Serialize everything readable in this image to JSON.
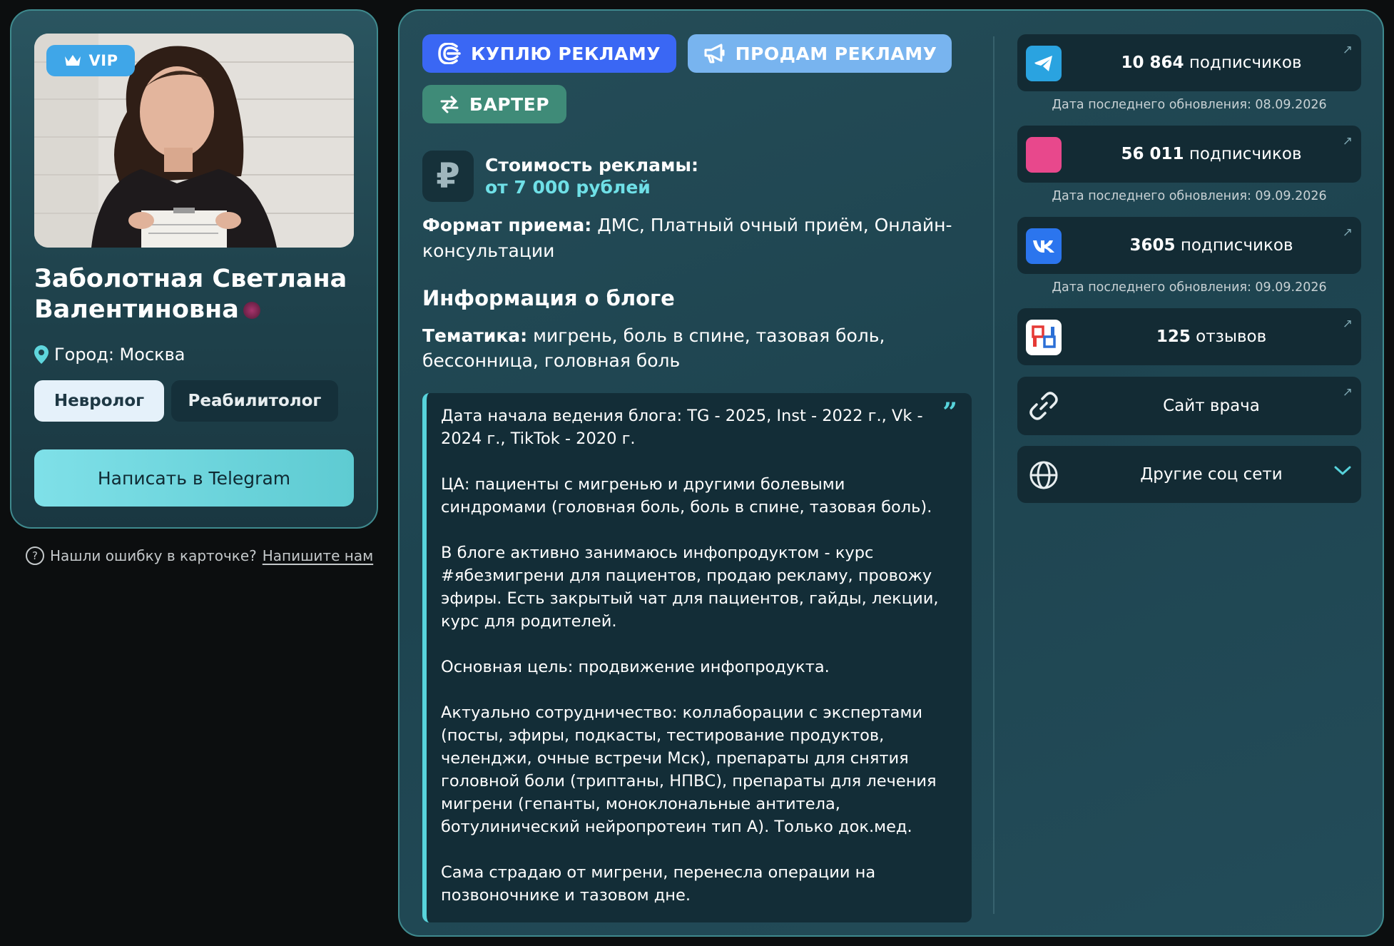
{
  "profile": {
    "vip_label": "VIP",
    "name": "Заболотная Светлана Валентиновна",
    "city": "Город: Москва",
    "specialties": [
      "Невролог",
      "Реабилитолог"
    ],
    "telegram_button": "Написать в Telegram",
    "error_text": "Нашли ошибку в карточке?",
    "error_link": "Напишите нам"
  },
  "ad_buttons": {
    "buy": "КУПЛЮ РЕКЛАМУ",
    "sell": "ПРОДАМ РЕКЛАМУ",
    "barter": "БАРТЕР"
  },
  "price": {
    "symbol": "₽",
    "title": "Стоимость рекламы:",
    "value": "от 7 000 рублей"
  },
  "format": {
    "label": "Формат приема:",
    "value": "ДМС, Платный очный приём, Онлайн-консультации"
  },
  "blog": {
    "heading": "Информация о блоге",
    "topic_label": "Тематика:",
    "topic_value": "мигрень, боль в спине, тазовая боль, бессонница, головная боль",
    "quote_mark": "”",
    "paragraphs": [
      "Дата начала ведения блога: TG - 2025, Inst - 2022 г., Vk - 2024 г., TikTok - 2020 г.",
      "ЦА: пациенты с мигренью и другими болевыми синдромами (головная боль, боль в спине, тазовая боль).",
      "В блоге активно занимаюсь инфопродуктом - курс #ябезмигрени для пациентов, продаю рекламу, провожу эфиры. Есть закрытый чат для пациентов, гайды, лекции, курс для родителей.",
      "Основная цель: продвижение инфопродукта.",
      "Актуально сотрудничество: коллаборации с экспертами (посты, эфиры, подкасты, тестирование продуктов, челенджи, очные встречи Мск), препараты для снятия головной боли (триптаны, НПВС), препараты для лечения мигрени (гепанты, моноклональные антитела, ботулинический нейропротеин тип А). Только док.мед.",
      "Сама страдаю от мигрени, перенесла операции на позвоночнике и тазовом дне."
    ]
  },
  "socials": [
    {
      "icon": "telegram-icon",
      "count": "10 864",
      "unit": "подписчиков",
      "date": "Дата последнего обновления: 08.09.2026",
      "color": "#2aa3e0"
    },
    {
      "icon": "instagram-icon",
      "count": "56 011",
      "unit": "подписчиков",
      "date": "Дата последнего обновления: 09.09.2026",
      "color": "#e8488c"
    },
    {
      "icon": "vk-icon",
      "count": "3605",
      "unit": "подписчиков",
      "date": "Дата последнего обновления: 09.09.2026",
      "color": "#2b75ee"
    },
    {
      "icon": "prodoctorov-icon",
      "count": "125",
      "unit": "отзывов"
    }
  ],
  "links": {
    "site": "Сайт врача",
    "other": "Другие соц сети"
  },
  "colors": {
    "accent_cyan": "#57d3db",
    "buy_blue": "#3a67f4",
    "sell_blue": "#78b4ef",
    "barter_green": "#3f8b78",
    "panel_border": "#3f8a8e"
  }
}
